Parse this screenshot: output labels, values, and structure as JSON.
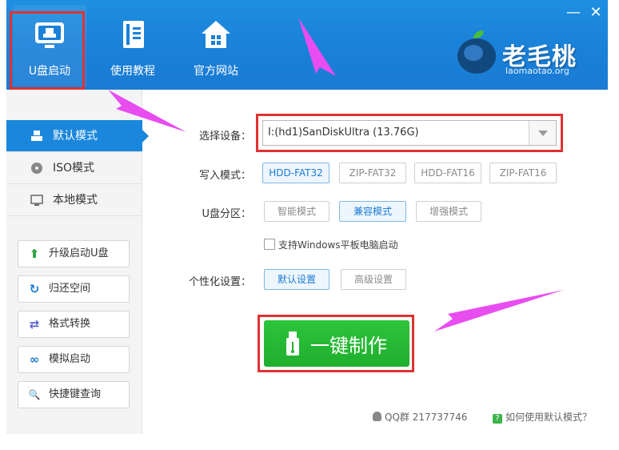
{
  "window": {
    "minimize_glyph": "—",
    "close_glyph": "✕"
  },
  "nav": [
    {
      "label": "U盘启动",
      "icon": "usb-monitor-icon"
    },
    {
      "label": "使用教程",
      "icon": "book-icon"
    },
    {
      "label": "官方网站",
      "icon": "home-icon"
    }
  ],
  "brand": {
    "name": "老毛桃",
    "domain": "laomaotao.org",
    "icon": "peach-logo-icon"
  },
  "sidebar": {
    "modes": [
      {
        "label": "默认模式",
        "icon": "drive-icon"
      },
      {
        "label": "ISO模式",
        "icon": "disc-icon"
      },
      {
        "label": "本地模式",
        "icon": "monitor-icon"
      }
    ],
    "tools": [
      {
        "label": "升级启动U盘",
        "icon": "up-arrow-icon",
        "glyph": "⬆",
        "color": "#2aa33a"
      },
      {
        "label": "归还空间",
        "icon": "refresh-icon",
        "glyph": "↻",
        "color": "#1b7bd4"
      },
      {
        "label": "格式转换",
        "icon": "swap-icon",
        "glyph": "⇄",
        "color": "#5a63c8"
      },
      {
        "label": "模拟启动",
        "icon": "link-icon",
        "glyph": "∞",
        "color": "#1b7bd4"
      },
      {
        "label": "快捷键查询",
        "icon": "search-icon",
        "glyph": "🔍",
        "color": "#d23c3c"
      }
    ]
  },
  "form": {
    "device_label": "选择设备：",
    "device_value": "I:(hd1)SanDiskUltra (13.76G)",
    "write_label": "写入模式：",
    "write_modes": [
      "HDD-FAT32",
      "ZIP-FAT32",
      "HDD-FAT16",
      "ZIP-FAT16"
    ],
    "partition_label": "U盘分区：",
    "partition_modes": [
      "智能模式",
      "兼容模式",
      "增强模式"
    ],
    "tablet_checkbox": "支持Windows平板电脑启动",
    "personal_label": "个性化设置：",
    "personal_modes": [
      "默认设置",
      "高级设置"
    ],
    "make_button": "一键制作"
  },
  "footer": {
    "qq": "QQ群 217737746",
    "help": "如何使用默认模式？",
    "help_mark": "?"
  },
  "colors": {
    "header": "#1b80d8",
    "accent": "#1b87dc",
    "make": "#22b22f",
    "highlight": "#e03232",
    "arrow": "#e84df0"
  }
}
